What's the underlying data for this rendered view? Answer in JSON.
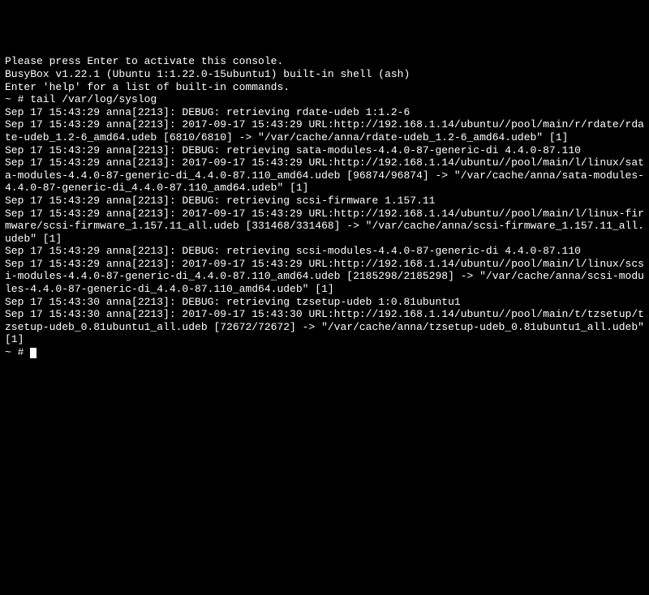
{
  "terminal": {
    "lines": [
      "Please press Enter to activate this console.",
      "",
      "",
      "BusyBox v1.22.1 (Ubuntu 1:1.22.0-15ubuntu1) built-in shell (ash)",
      "Enter 'help' for a list of built-in commands.",
      "",
      "~ # tail /var/log/syslog",
      "Sep 17 15:43:29 anna[2213]: DEBUG: retrieving rdate-udeb 1:1.2-6",
      "Sep 17 15:43:29 anna[2213]: 2017-09-17 15:43:29 URL:http://192.168.1.14/ubuntu//pool/main/r/rdate/rdate-udeb_1.2-6_amd64.udeb [6810/6810] -> \"/var/cache/anna/rdate-udeb_1.2-6_amd64.udeb\" [1]",
      "Sep 17 15:43:29 anna[2213]: DEBUG: retrieving sata-modules-4.4.0-87-generic-di 4.4.0-87.110",
      "Sep 17 15:43:29 anna[2213]: 2017-09-17 15:43:29 URL:http://192.168.1.14/ubuntu//pool/main/l/linux/sata-modules-4.4.0-87-generic-di_4.4.0-87.110_amd64.udeb [96874/96874] -> \"/var/cache/anna/sata-modules-4.4.0-87-generic-di_4.4.0-87.110_amd64.udeb\" [1]",
      "Sep 17 15:43:29 anna[2213]: DEBUG: retrieving scsi-firmware 1.157.11",
      "Sep 17 15:43:29 anna[2213]: 2017-09-17 15:43:29 URL:http://192.168.1.14/ubuntu//pool/main/l/linux-firmware/scsi-firmware_1.157.11_all.udeb [331468/331468] -> \"/var/cache/anna/scsi-firmware_1.157.11_all.udeb\" [1]",
      "Sep 17 15:43:29 anna[2213]: DEBUG: retrieving scsi-modules-4.4.0-87-generic-di 4.4.0-87.110",
      "Sep 17 15:43:29 anna[2213]: 2017-09-17 15:43:29 URL:http://192.168.1.14/ubuntu//pool/main/l/linux/scsi-modules-4.4.0-87-generic-di_4.4.0-87.110_amd64.udeb [2185298/2185298] -> \"/var/cache/anna/scsi-modules-4.4.0-87-generic-di_4.4.0-87.110_amd64.udeb\" [1]",
      "Sep 17 15:43:30 anna[2213]: DEBUG: retrieving tzsetup-udeb 1:0.81ubuntu1",
      "Sep 17 15:43:30 anna[2213]: 2017-09-17 15:43:30 URL:http://192.168.1.14/ubuntu//pool/main/t/tzsetup/tzsetup-udeb_0.81ubuntu1_all.udeb [72672/72672] -> \"/var/cache/anna/tzsetup-udeb_0.81ubuntu1_all.udeb\" [1]",
      "~ # "
    ]
  }
}
